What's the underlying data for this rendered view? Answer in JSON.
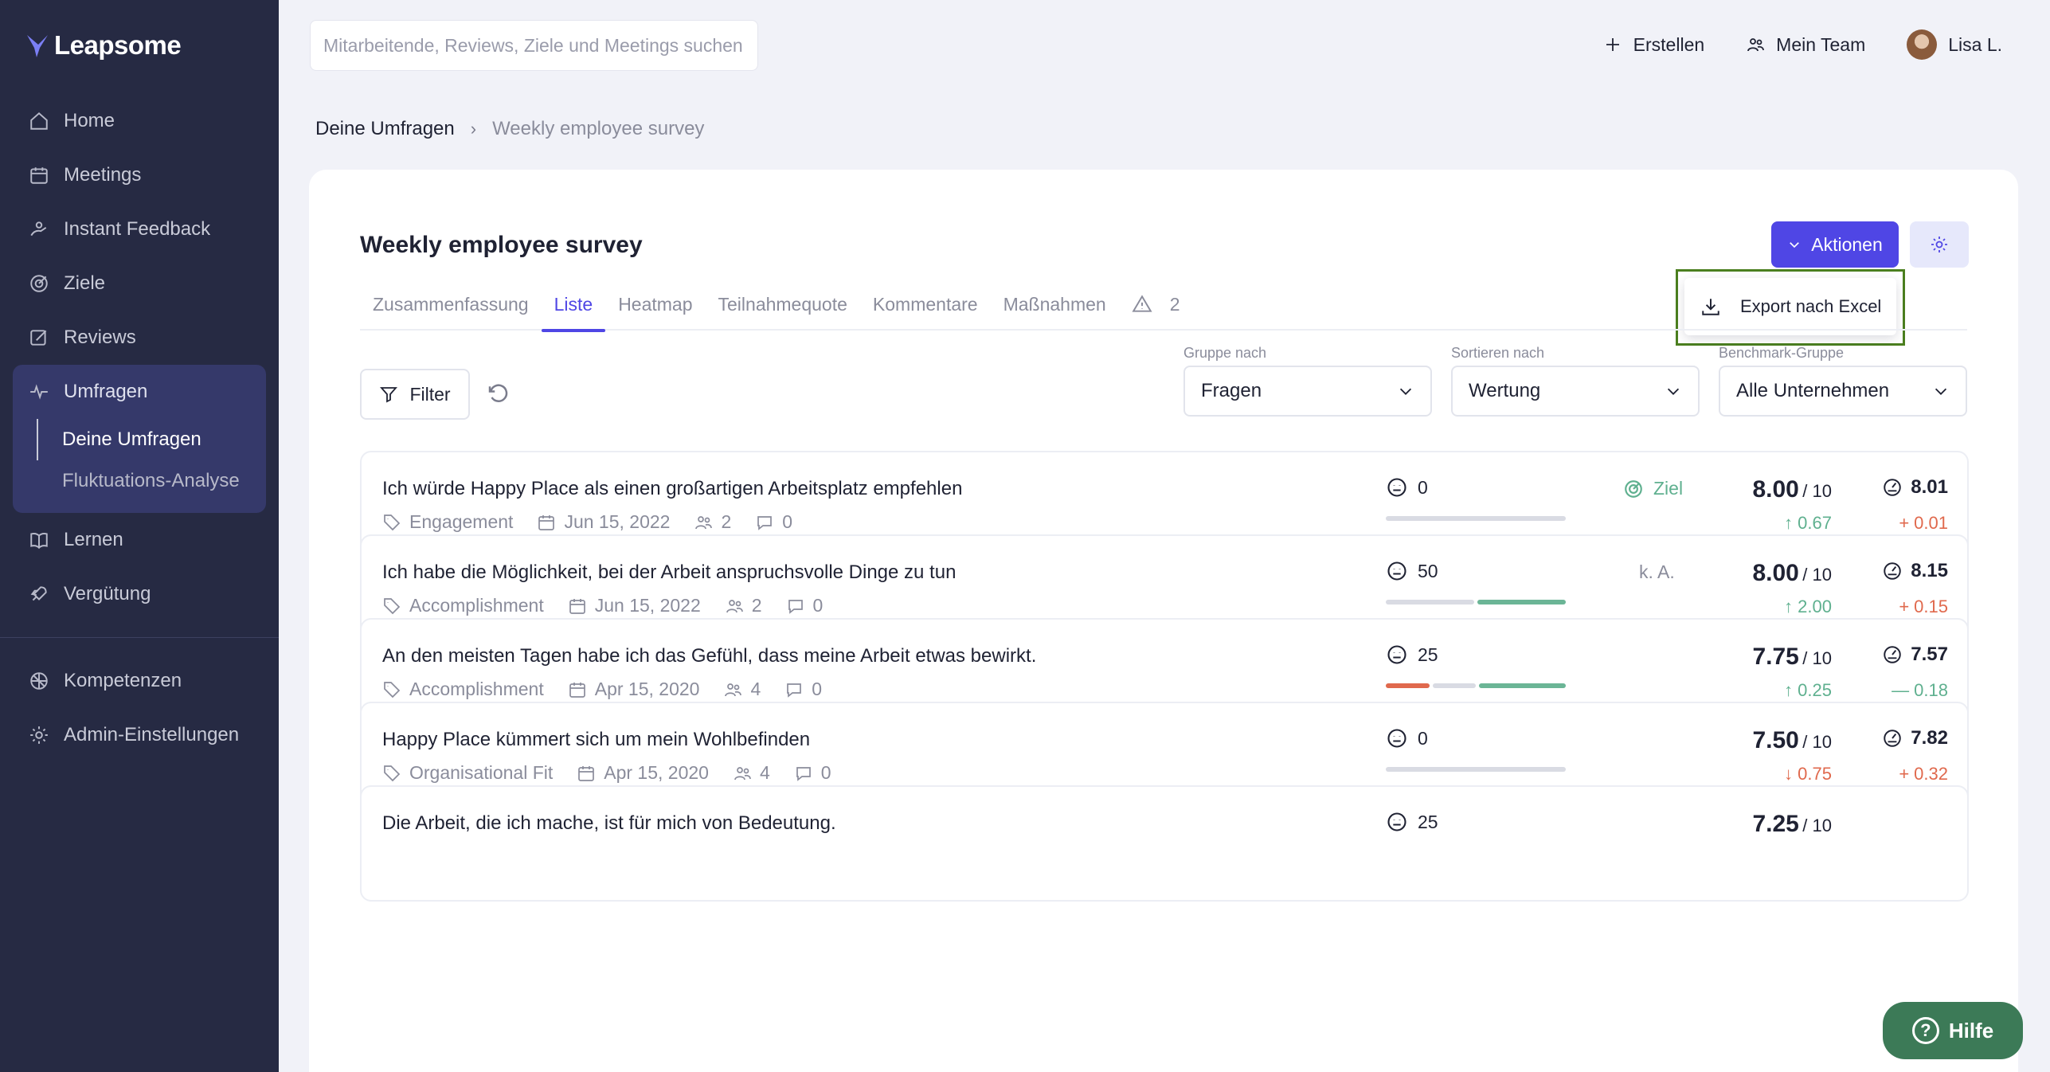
{
  "app": {
    "name": "Leapsome"
  },
  "sidebar": {
    "items": [
      {
        "label": "Home",
        "icon": "home-icon"
      },
      {
        "label": "Meetings",
        "icon": "calendar-icon"
      },
      {
        "label": "Instant Feedback",
        "icon": "feedback-icon"
      },
      {
        "label": "Ziele",
        "icon": "target-icon"
      },
      {
        "label": "Reviews",
        "icon": "edit-icon"
      },
      {
        "label": "Umfragen",
        "icon": "pulse-icon"
      }
    ],
    "umfragen_sub": [
      {
        "label": "Deine Umfragen",
        "active": true
      },
      {
        "label": "Fluktuations-Analyse",
        "active": false
      }
    ],
    "items_after": [
      {
        "label": "Lernen",
        "icon": "book-icon"
      },
      {
        "label": "Vergütung",
        "icon": "rocket-icon"
      }
    ],
    "items_bottom": [
      {
        "label": "Kompetenzen",
        "icon": "competency-icon"
      },
      {
        "label": "Admin-Einstellungen",
        "icon": "gear-icon"
      }
    ]
  },
  "topbar": {
    "search_placeholder": "Mitarbeitende, Reviews, Ziele und Meetings suchen",
    "create_label": "Erstellen",
    "team_label": "Mein Team",
    "user_label": "Lisa L."
  },
  "breadcrumb": {
    "parent": "Deine Umfragen",
    "current": "Weekly employee survey"
  },
  "survey": {
    "title": "Weekly employee survey",
    "actions_label": "Aktionen",
    "export_label": "Export nach Excel",
    "tabs": [
      "Zusammenfassung",
      "Liste",
      "Heatmap",
      "Teilnahmequote",
      "Kommentare",
      "Maßnahmen"
    ],
    "active_tab": "Liste",
    "warning_count": "2",
    "filter_label": "Filter",
    "group_by": {
      "label": "Gruppe nach",
      "value": "Fragen"
    },
    "sort_by": {
      "label": "Sortieren nach",
      "value": "Wertung"
    },
    "benchmark": {
      "label": "Benchmark-Gruppe",
      "value": "Alle Unternehmen"
    }
  },
  "questions": [
    {
      "text": "Ich würde Happy Place als einen großartigen Arbeitsplatz empfehlen",
      "category": "Engagement",
      "date": "Jun 15, 2022",
      "participants": "2",
      "comments": "0",
      "response_label": "0",
      "goal": "Ziel",
      "goal_type": "target",
      "score": "8.00",
      "scale": "/ 10",
      "delta": "0.67",
      "delta_dir": "up",
      "benchmark": "8.01",
      "bench_delta": "0.01",
      "bench_dir": "plus",
      "bar": [
        {
          "color": "#d9dbe3",
          "pct": 100
        }
      ]
    },
    {
      "text": "Ich habe die Möglichkeit, bei der Arbeit anspruchsvolle Dinge zu tun",
      "category": "Accomplishment",
      "date": "Jun 15, 2022",
      "participants": "2",
      "comments": "0",
      "response_label": "50",
      "goal": "k. A.",
      "goal_type": "na",
      "score": "8.00",
      "scale": "/ 10",
      "delta": "2.00",
      "delta_dir": "up",
      "benchmark": "8.15",
      "bench_delta": "0.15",
      "bench_dir": "plus",
      "bar": [
        {
          "color": "#d9dbe3",
          "pct": 50
        },
        {
          "color": "#6bb596",
          "pct": 50
        }
      ]
    },
    {
      "text": "An den meisten Tagen habe ich das Gefühl, dass meine Arbeit etwas bewirkt.",
      "category": "Accomplishment",
      "date": "Apr 15, 2020",
      "participants": "4",
      "comments": "0",
      "response_label": "25",
      "goal": "",
      "goal_type": "none",
      "score": "7.75",
      "scale": "/ 10",
      "delta": "0.25",
      "delta_dir": "up",
      "benchmark": "7.57",
      "bench_delta": "0.18",
      "bench_dir": "minus",
      "bar": [
        {
          "color": "#e0694d",
          "pct": 25
        },
        {
          "color": "#d9dbe3",
          "pct": 25
        },
        {
          "color": "#6bb596",
          "pct": 50
        }
      ]
    },
    {
      "text": "Happy Place kümmert sich um mein Wohlbefinden",
      "category": "Organisational Fit",
      "date": "Apr 15, 2020",
      "participants": "4",
      "comments": "0",
      "response_label": "0",
      "goal": "",
      "goal_type": "none",
      "score": "7.50",
      "scale": "/ 10",
      "delta": "0.75",
      "delta_dir": "down",
      "benchmark": "7.82",
      "bench_delta": "0.32",
      "bench_dir": "plus",
      "bar": [
        {
          "color": "#d9dbe3",
          "pct": 100
        }
      ]
    },
    {
      "text": "Die Arbeit, die ich mache, ist für mich von Bedeutung.",
      "category": "",
      "date": "",
      "participants": "",
      "comments": "",
      "response_label": "25",
      "goal": "",
      "goal_type": "none",
      "score": "7.25",
      "scale": "/ 10",
      "delta": "",
      "delta_dir": "",
      "benchmark": "",
      "bench_delta": "",
      "bench_dir": "",
      "bar": []
    }
  ],
  "help_label": "Hilfe",
  "colors": {
    "accent": "#4f46e5",
    "sidebar": "#262a43",
    "positive": "#5fb08f",
    "negative": "#e0694d",
    "highlight": "#4b7f1f"
  }
}
